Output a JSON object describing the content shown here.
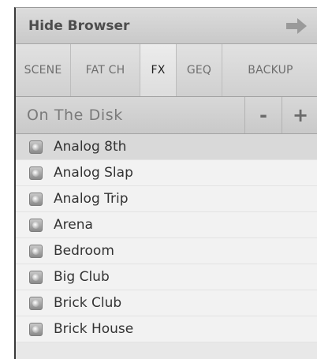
{
  "header": {
    "hide_label": "Hide Browser",
    "icon": "arrow-right-icon"
  },
  "tabs": [
    {
      "label": "SCENE",
      "active": false
    },
    {
      "label": "FAT CH",
      "active": false
    },
    {
      "label": "FX",
      "active": true
    },
    {
      "label": "GEQ",
      "active": false
    },
    {
      "label": "BACKUP",
      "active": false
    }
  ],
  "disk_bar": {
    "title": "On The Disk",
    "minus_label": "-",
    "plus_label": "+"
  },
  "list": {
    "icon": "preset-file-icon",
    "selected_index": 0,
    "items": [
      {
        "label": "Analog 8th"
      },
      {
        "label": "Analog Slap"
      },
      {
        "label": "Analog Trip"
      },
      {
        "label": "Arena"
      },
      {
        "label": "Bedroom"
      },
      {
        "label": "Big Club"
      },
      {
        "label": "Brick Club"
      },
      {
        "label": "Brick House"
      }
    ]
  }
}
